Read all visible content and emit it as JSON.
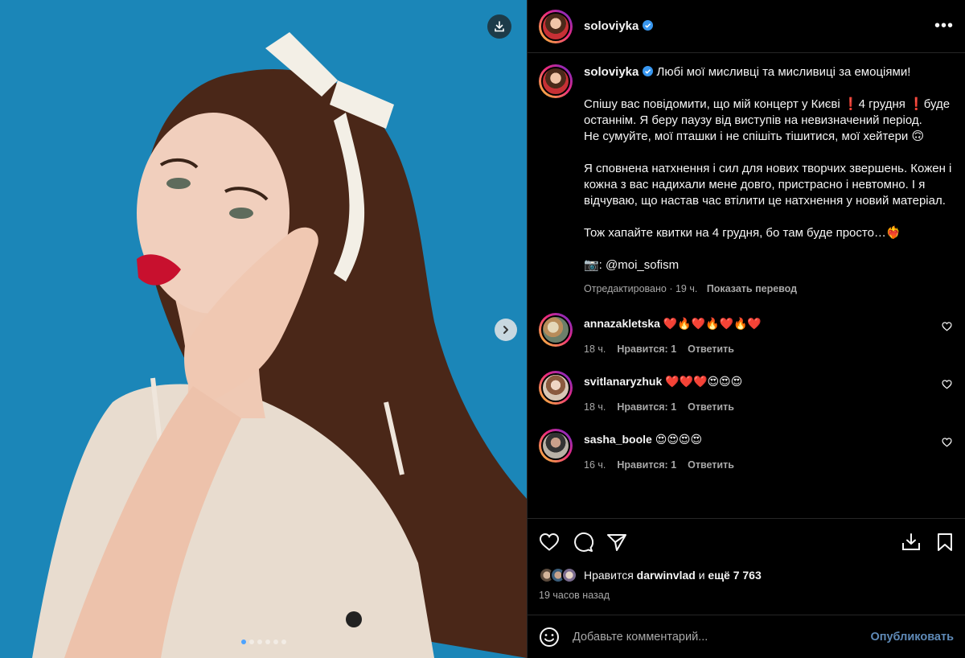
{
  "post": {
    "username": "soloviyka",
    "caption": {
      "lines": [
        "Любі мої мисливці та мисливиці за емоціями!",
        "",
        "Спішу вас повідомити, що мій концерт у Києві ❗️4 грудня ❗️буде останнім. Я беру паузу від виступів на невизначений період.",
        "Не сумуйте, мої пташки і не спішіть тішитися, мої хейтери 🙃",
        "",
        "Я сповнена натхнення і сил для нових творчих звершень. Кожен і кожна з вас надихали мене довго, пристрасно і невтомно. І я відчуваю, що настав час втілити це натхнення у новий матеріал.",
        "",
        "Тож хапайте квитки на 4 грудня, бо там буде просто…❤️‍🔥",
        "",
        "📷: @moi_sofism"
      ],
      "edited": "Отредактировано · 19 ч.",
      "translate": "Показать перевод"
    },
    "comments": [
      {
        "username": "annazakletska",
        "text": "❤️🔥❤️🔥❤️🔥❤️",
        "time": "18 ч.",
        "likes": "Нравится: 1",
        "reply": "Ответить"
      },
      {
        "username": "svitlanaryzhuk",
        "text": "❤️❤️❤️😍😍😍",
        "time": "18 ч.",
        "likes": "Нравится: 1",
        "reply": "Ответить"
      },
      {
        "username": "sasha_boole",
        "text": "😍😍😍😍",
        "time": "16 ч.",
        "likes": "Нравится: 1",
        "reply": "Ответить"
      }
    ],
    "likes": {
      "prefix": "Нравится",
      "user": "darwinvlad",
      "mid": "и",
      "more": "ещё 7 763"
    },
    "posted": "19 часов назад",
    "comment_placeholder": "Добавьте комментарий...",
    "publish_label": "Опубликовать"
  },
  "media": {
    "slides": 6,
    "active_slide": 0
  },
  "colors": {
    "background": "#000000",
    "media_bg": "#1b86b8",
    "verified": "#3897f0",
    "publish": "#70a3d8"
  }
}
